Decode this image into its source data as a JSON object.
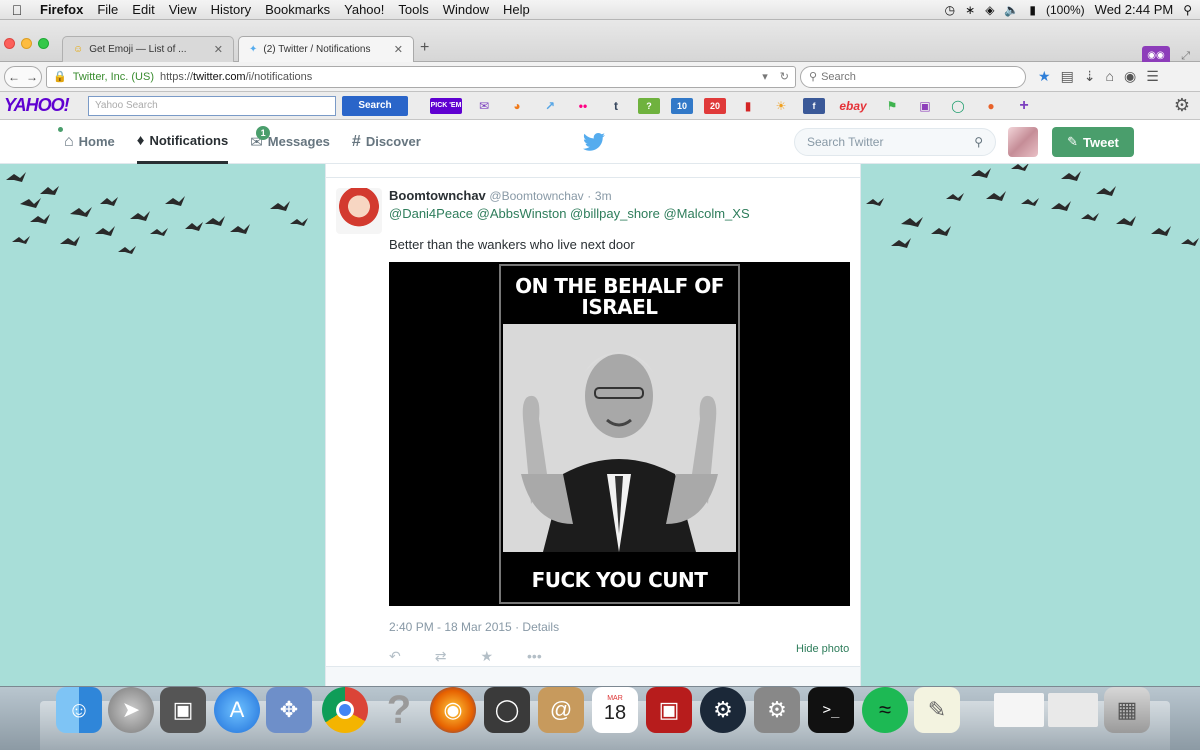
{
  "menubar": {
    "app": "Firefox",
    "items": [
      "File",
      "Edit",
      "View",
      "History",
      "Bookmarks",
      "Yahoo!",
      "Tools",
      "Window",
      "Help"
    ],
    "battery": "(100%)",
    "clock": "Wed 2:44 PM"
  },
  "tabs": [
    {
      "label": "Get Emoji — List of ..."
    },
    {
      "label": "(2) Twitter / Notifications"
    }
  ],
  "navbar": {
    "site_identity": "Twitter, Inc. (US)",
    "url_prefix": "https://",
    "url_host": "twitter.com",
    "url_path": "/i/notifications",
    "search_placeholder": "Search"
  },
  "yahoo": {
    "logo": "YAHOO!",
    "search_placeholder": "Yahoo Search",
    "search_button": "Search",
    "pick_em": "PICK 'EM",
    "badge_10": "10",
    "badge_20": "20",
    "ebay": "ebay"
  },
  "twitter_nav": {
    "home": "Home",
    "notifications": "Notifications",
    "messages": "Messages",
    "messages_badge": "1",
    "discover": "Discover",
    "search_placeholder": "Search Twitter",
    "tweet_button": "Tweet"
  },
  "tweet": {
    "name": "Boomtownchav",
    "handle": "@Boomtownchav",
    "age": "3m",
    "mentions": "@Dani4Peace @AbbsWinston @billpay_shore @Malcolm_XS",
    "text": "Better than the wankers who live next door",
    "image_top_text": "ON THE BEHALF OF ISRAEL",
    "image_bottom_text": "FUCK YOU CUNT",
    "timestamp": "2:40 PM - 18 Mar 2015",
    "details": "Details",
    "hide_photo": "Hide photo"
  },
  "dock": {
    "calendar_month": "MAR",
    "calendar_day": "18"
  },
  "colors": {
    "twitter_green": "#4a9e6c",
    "page_background": "#a8ded8",
    "yahoo_purple": "#5f01d1",
    "yahoo_button": "#2a65c9"
  }
}
